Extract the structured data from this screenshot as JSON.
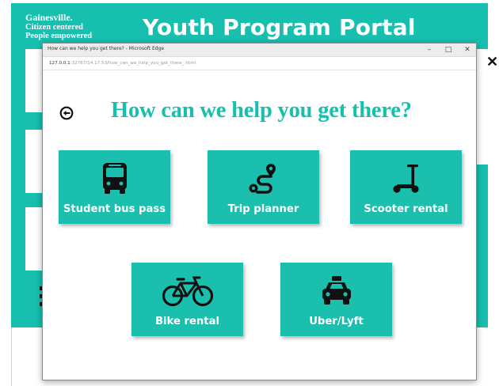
{
  "portal": {
    "brand_line1": "Gainesville.",
    "brand_line2": "Citizen centered",
    "brand_line3": "People empowered",
    "title": "Youth Program Portal",
    "accent_color": "#17bfae"
  },
  "popup": {
    "window_title": "How can we help you get there? - Microsoft Edge",
    "url_host": "127.0.0.1",
    "url_rest": ":32767/14.17.53/how_can_we_help_you_get_there_.html",
    "heading": "How can we help you get there?",
    "back_icon": "back-arrow-icon"
  },
  "tiles": [
    {
      "label": "Student bus pass",
      "icon": "bus-icon"
    },
    {
      "label": "Trip planner",
      "icon": "route-icon"
    },
    {
      "label": "Scooter rental",
      "icon": "scooter-icon"
    },
    {
      "label": "Bike rental",
      "icon": "bicycle-icon"
    },
    {
      "label": "Uber/Lyft",
      "icon": "car-icon"
    }
  ]
}
